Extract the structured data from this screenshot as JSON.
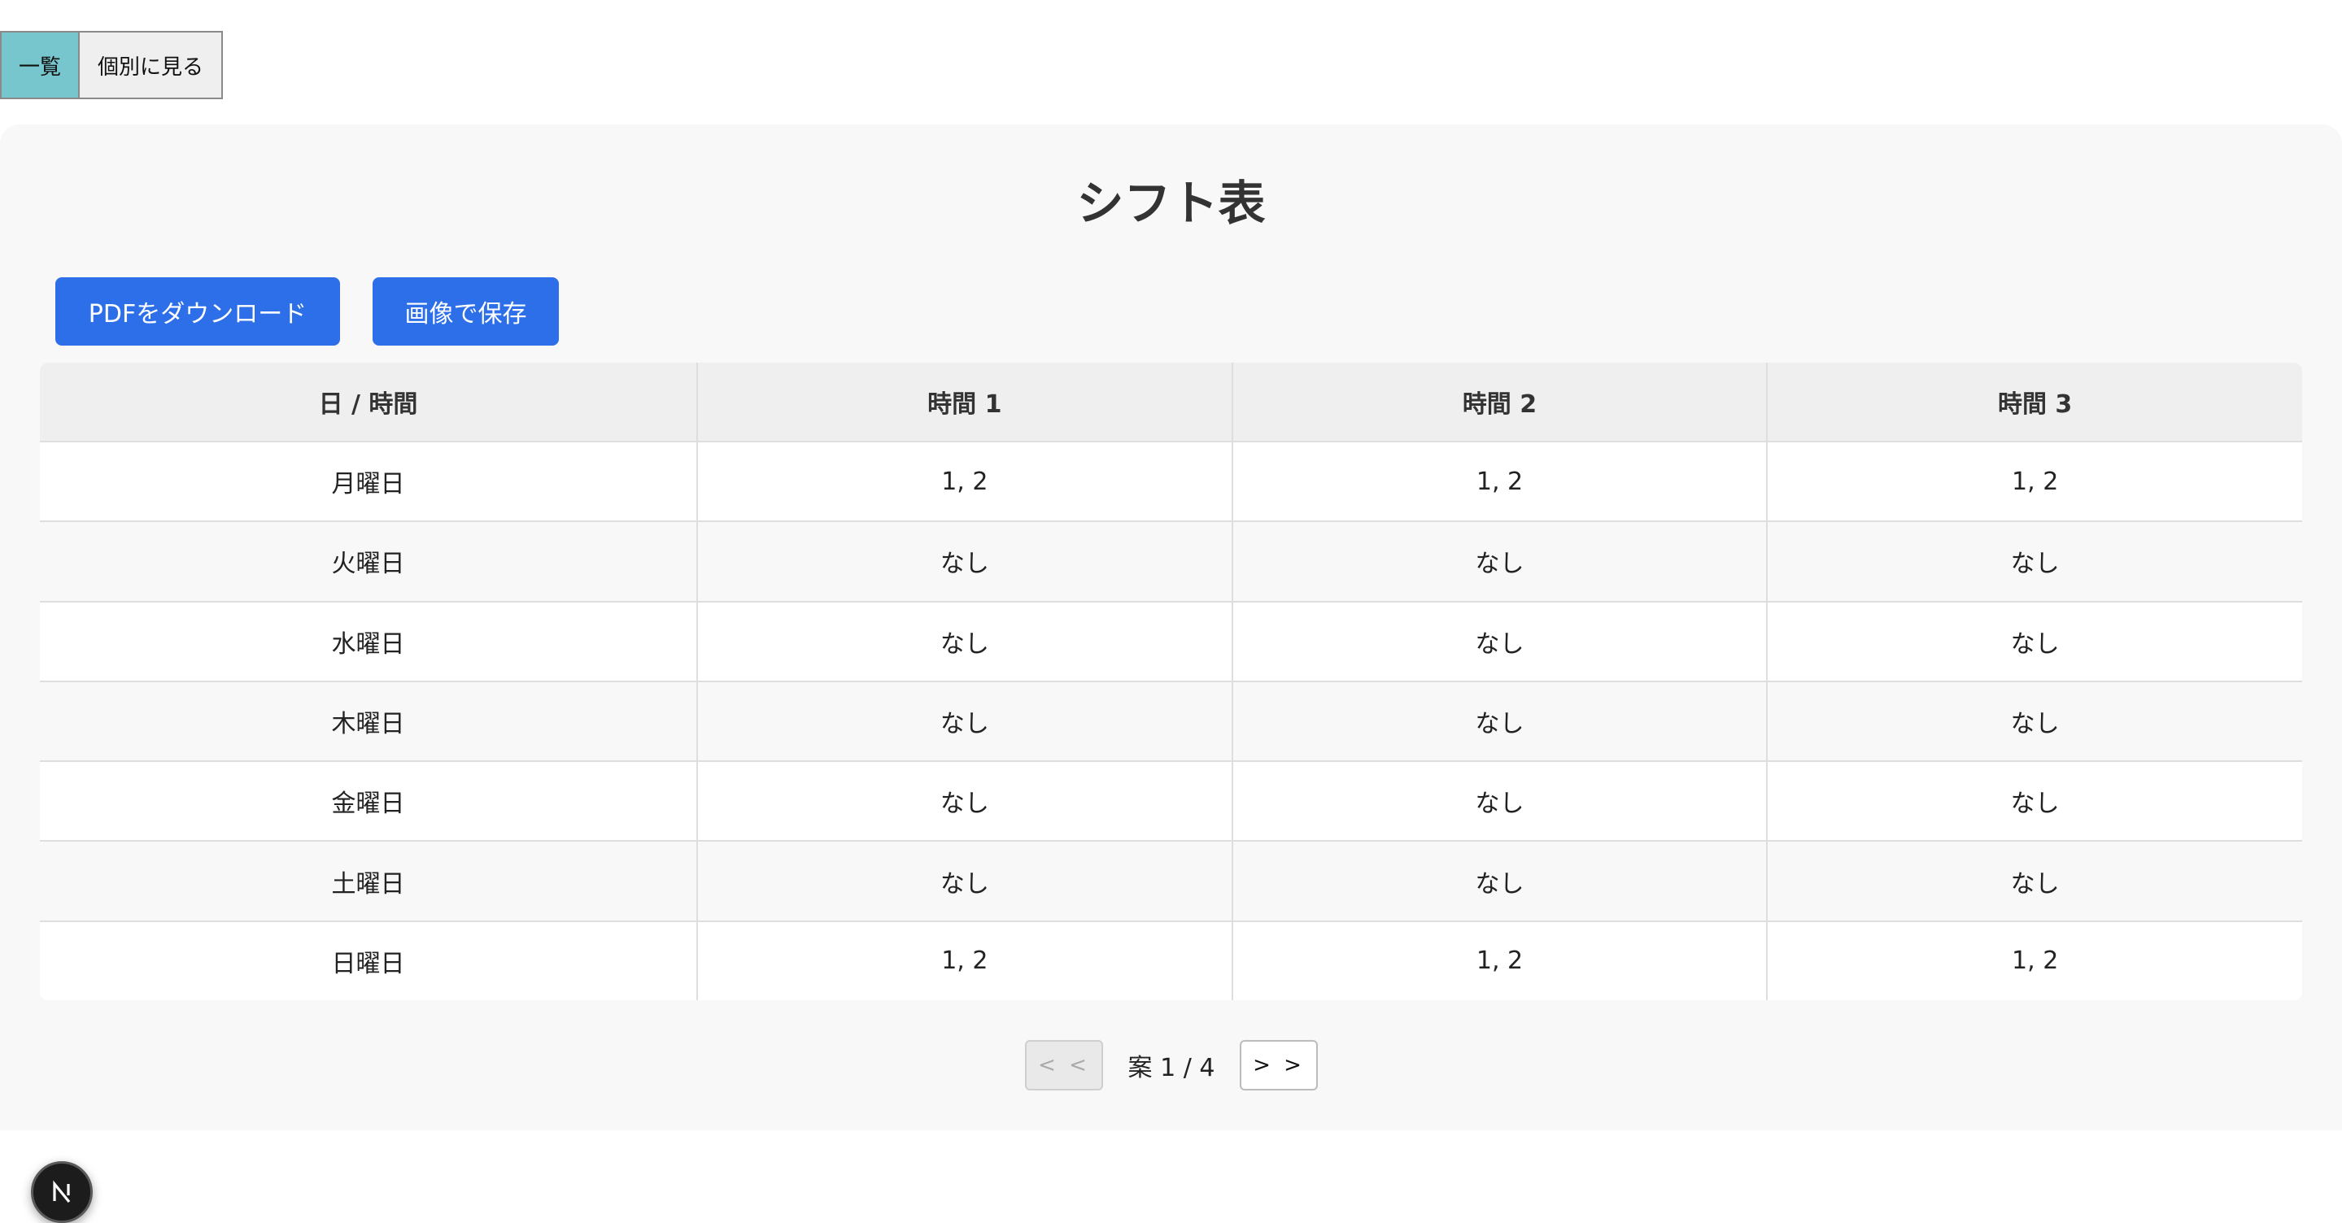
{
  "view_tabs": {
    "list_label": "一覧",
    "individual_label": "個別に見る"
  },
  "title": "シフト表",
  "actions": {
    "pdf_label": "PDFをダウンロード",
    "image_label": "画像で保存"
  },
  "table": {
    "headers": [
      "日 / 時間",
      "時間 1",
      "時間 2",
      "時間 3"
    ],
    "rows": [
      [
        "月曜日",
        "1, 2",
        "1, 2",
        "1, 2"
      ],
      [
        "火曜日",
        "なし",
        "なし",
        "なし"
      ],
      [
        "水曜日",
        "なし",
        "なし",
        "なし"
      ],
      [
        "木曜日",
        "なし",
        "なし",
        "なし"
      ],
      [
        "金曜日",
        "なし",
        "なし",
        "なし"
      ],
      [
        "土曜日",
        "なし",
        "なし",
        "なし"
      ],
      [
        "日曜日",
        "1, 2",
        "1, 2",
        "1, 2"
      ]
    ]
  },
  "pager": {
    "prev_label": "< <",
    "info": "案 1 / 4",
    "next_label": "> >"
  },
  "badge": {
    "icon": "nextjs-logo-icon"
  },
  "colors": {
    "tab_active": "#78c6cd",
    "primary_button": "#2c6fe8"
  }
}
